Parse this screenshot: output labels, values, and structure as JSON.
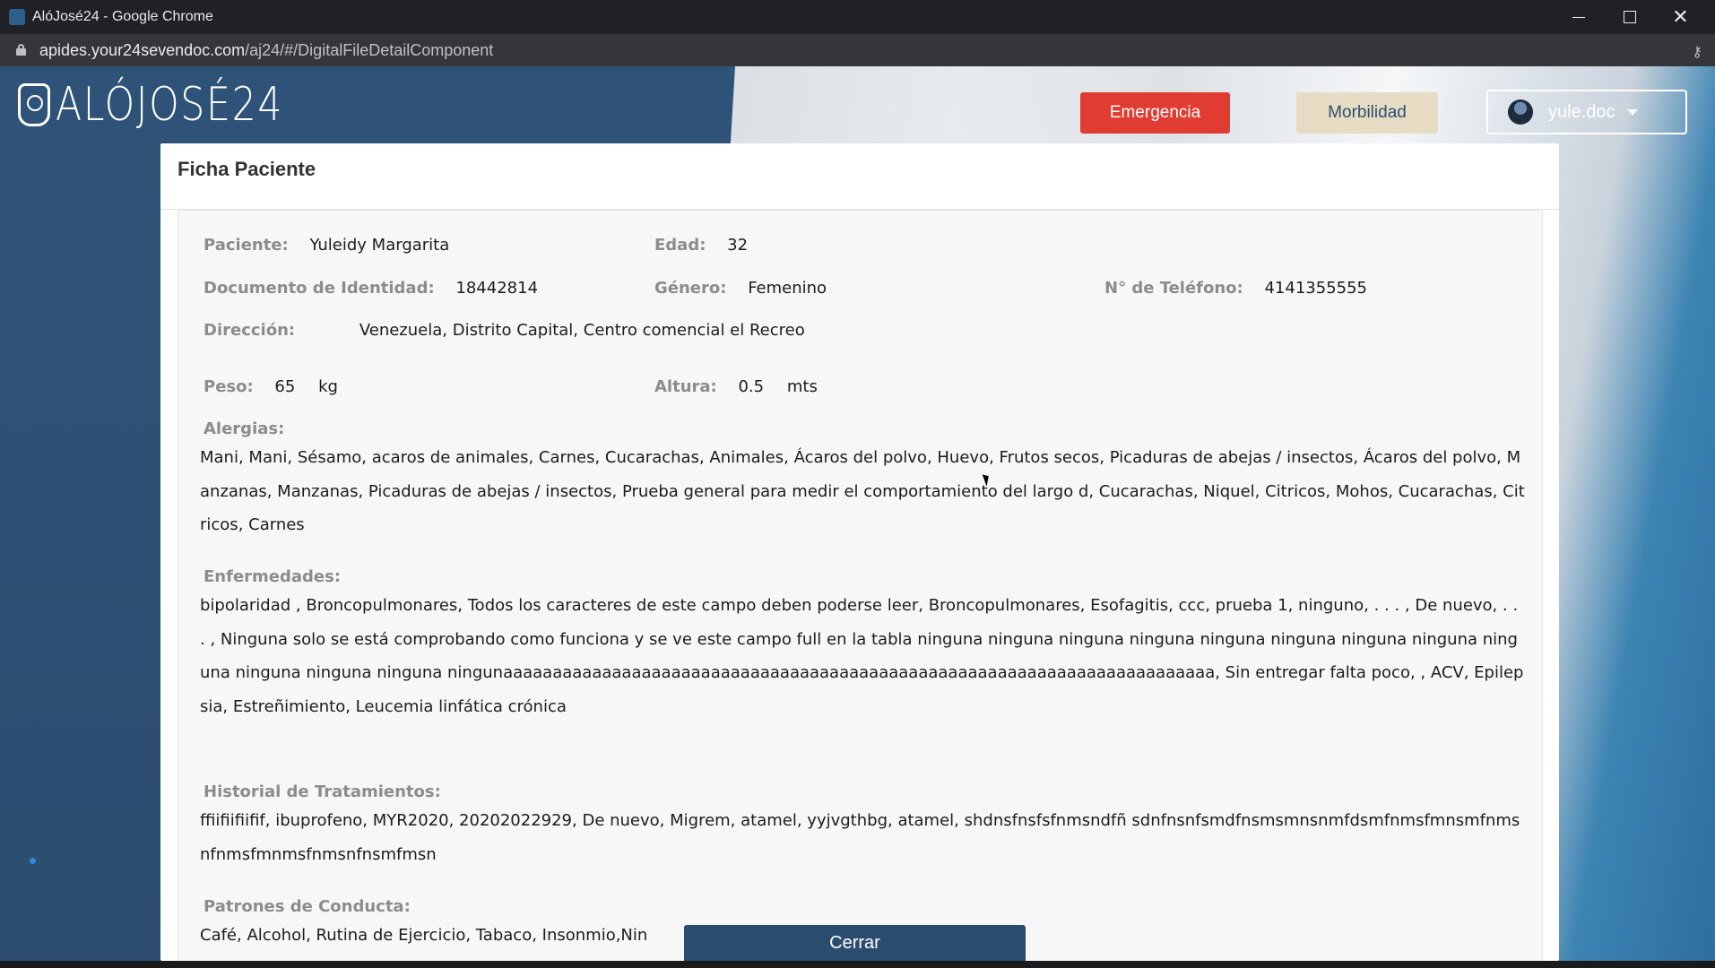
{
  "window": {
    "title": "AlóJosé24 - Google Chrome"
  },
  "browser": {
    "url_host": "apides.your24sevendoc.com",
    "url_path": "/aj24/#/DigitalFileDetailComponent"
  },
  "header": {
    "logo_text": "ALÓJOSÉ24",
    "emergencia_label": "Emergencia",
    "morbilidad_label": "Morbilidad",
    "user_name": "yule.doc"
  },
  "modal": {
    "title": "Ficha Paciente",
    "paciente_label": "Paciente:",
    "paciente_value": "Yuleidy Margarita",
    "edad_label": "Edad:",
    "edad_value": "32",
    "documento_label": "Documento de Identidad:",
    "documento_value": "18442814",
    "genero_label": "Género:",
    "genero_value": "Femenino",
    "telefono_label": "N° de Teléfono:",
    "telefono_value": "4141355555",
    "direccion_label": "Dirección:",
    "direccion_value": "Venezuela, Distrito Capital, Centro comencial el Recreo",
    "peso_label": "Peso:",
    "peso_value": "65",
    "peso_unit": "kg",
    "altura_label": "Altura:",
    "altura_value": "0.5",
    "altura_unit": "mts",
    "alergias_label": "Alergias:",
    "alergias_text": "Mani, Mani, Sésamo, acaros de animales, Carnes, Cucarachas, Animales, Ácaros del polvo, Huevo, Frutos secos, Picaduras de abejas / insectos, Ácaros del polvo, Manzanas, Manzanas, Picaduras de abejas / insectos, Prueba general para medir el comportamiento del largo d, Cucarachas, Niquel, Citricos, Mohos, Cucarachas, Citricos, Carnes",
    "enfermedades_label": "Enfermedades:",
    "enfermedades_text": "bipolaridad , Broncopulmonares, Todos los caracteres de este campo deben poderse leer, Broncopulmonares, Esofagitis, ccc, prueba 1, ninguno, . . . , De nuevo, . . . , Ninguna solo se está comprobando como funciona y se ve este campo full en la tabla ninguna ninguna ninguna ninguna ninguna ninguna ninguna ninguna ninguna ninguna ninguna ninguna ningunaaaaaaaaaaaaaaaaaaaaaaaaaaaaaaaaaaaaaaaaaaaaaaaaaaaaaaaaaaaaaaaaaaaaaaaa, Sin entregar falta poco, , ACV, Epilepsia, Estreñimiento, Leucemia linfática crónica",
    "tratamientos_label": "Historial de Tratamientos:",
    "tratamientos_text": "ffiifiifiifif, ibuprofeno, MYR2020, 20202022929, De nuevo, Migrem, atamel, yyjvgthbg, atamel, shdnsfnsfsfnmsndfñ sdnfnsnfsmdfnsmsmnsnmfdsmfnmsfmnsmfnmsnfnmsfmnmsfnmsnfnsmfmsn",
    "conducta_label": "Patrones de Conducta:",
    "conducta_text": "Café, Alcohol, Rutina de Ejercicio, Tabaco, Insonmio,Nin",
    "cerrar_label": "Cerrar"
  }
}
